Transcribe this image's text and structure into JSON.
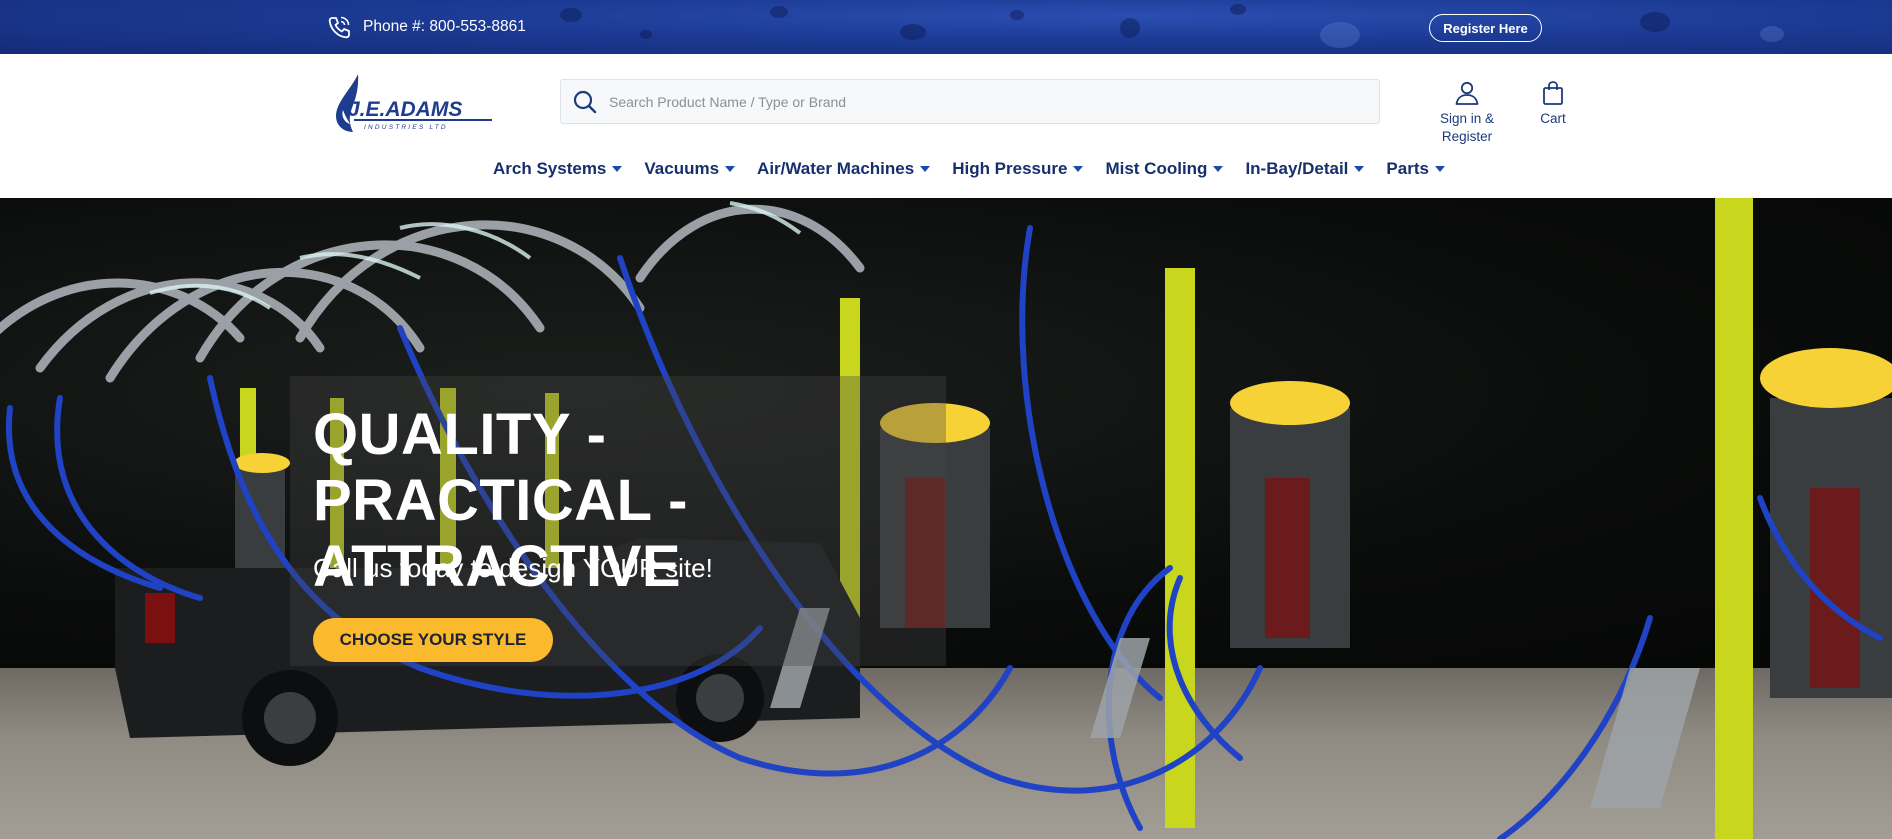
{
  "topbar": {
    "phone": "Phone #: 800-553-8861",
    "register_label": "Register Here",
    "background_color": "#1c3a94"
  },
  "header": {
    "logo_text": "J.E.ADAMS",
    "logo_subtext": "INDUSTRIES LTD",
    "search": {
      "placeholder": "Search Product Name / Type or Brand",
      "value": ""
    },
    "account_label": "Sign in & Register",
    "cart_label": "Cart",
    "text_color": "#1c3a7c"
  },
  "nav": {
    "items": [
      {
        "label": "Arch Systems"
      },
      {
        "label": "Vacuums"
      },
      {
        "label": "Air/Water Machines"
      },
      {
        "label": "High Pressure"
      },
      {
        "label": "Mist Cooling"
      },
      {
        "label": "In-Bay/Detail"
      },
      {
        "label": "Parts"
      }
    ]
  },
  "hero": {
    "title": "QUALITY - PRACTICAL - ATTRACTIVE",
    "subtitle": "Call us today to design YOUR site!",
    "cta_label": "CHOOSE YOUR STYLE",
    "cta_color": "#fbb92e"
  },
  "icons": {
    "phone": "phone-icon",
    "search": "search-icon",
    "account": "user-icon",
    "cart": "cart-bag-icon",
    "nav_caret": "caret-down-icon"
  }
}
